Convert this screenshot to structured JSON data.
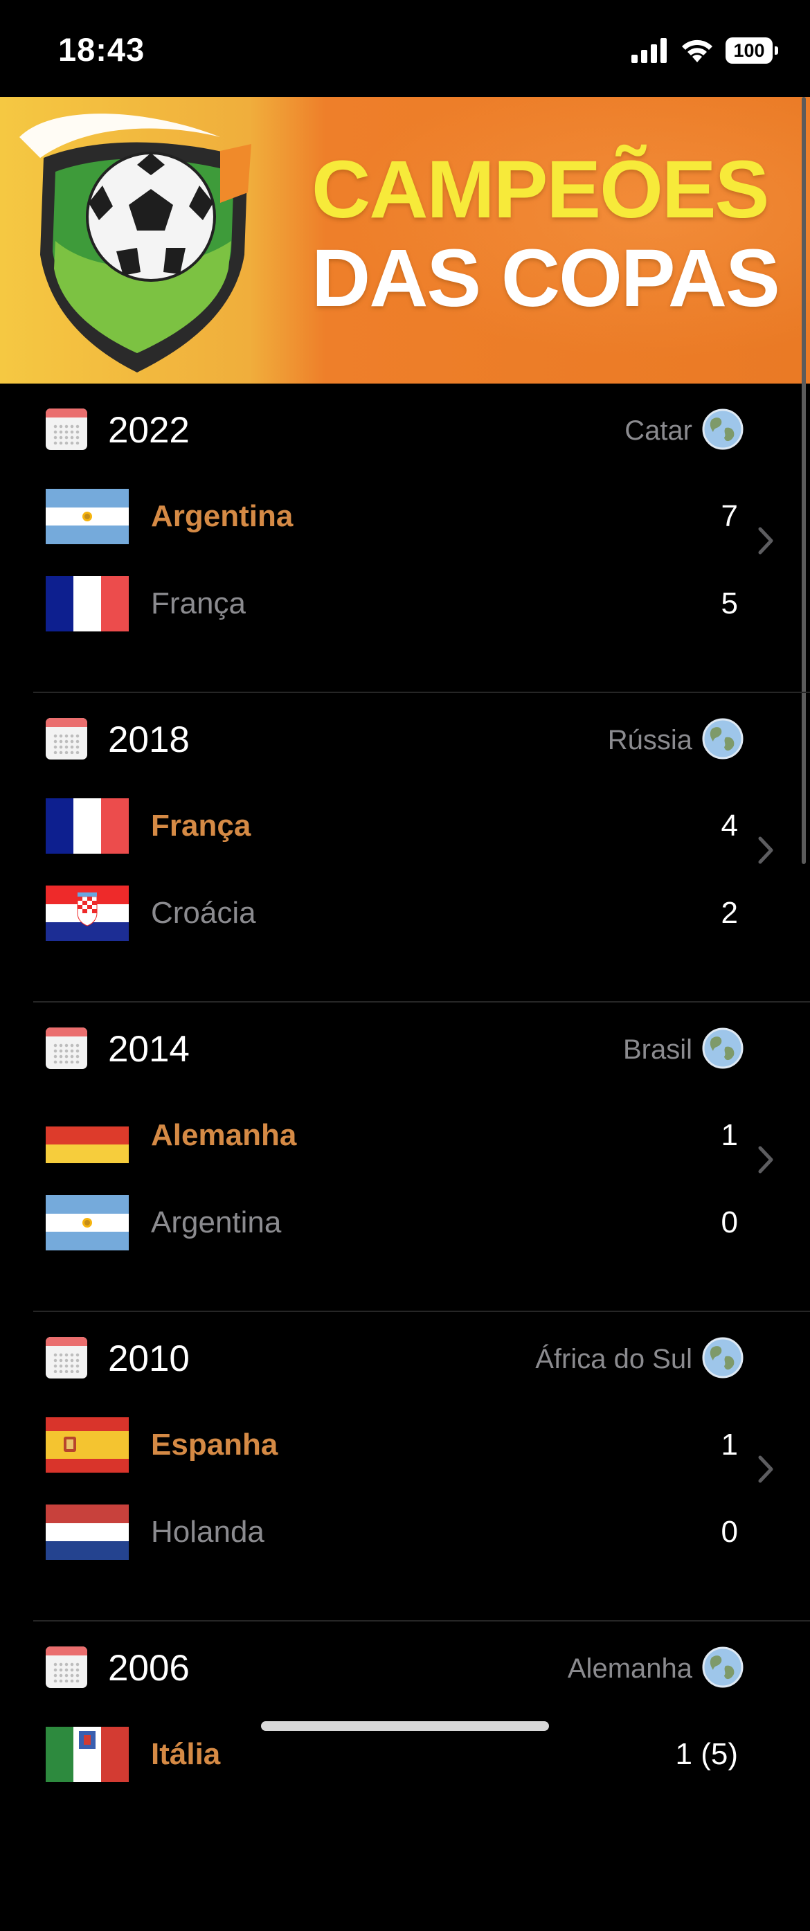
{
  "status_bar": {
    "time": "18:43",
    "battery": "100"
  },
  "banner": {
    "title_line1": "CAMPEÕES",
    "title_line2": "DAS COPAS"
  },
  "colors": {
    "winner": "#d58a45",
    "runner_up": "#8b8b8f",
    "banner_orange": "#ea7a25",
    "banner_yellow": "#f5c842"
  },
  "matches": [
    {
      "year": "2022",
      "host": "Catar",
      "winner": {
        "name": "Argentina",
        "score": "7",
        "flag": "argentina"
      },
      "runner_up": {
        "name": "França",
        "score": "5",
        "flag": "france"
      }
    },
    {
      "year": "2018",
      "host": "Rússia",
      "winner": {
        "name": "França",
        "score": "4",
        "flag": "france"
      },
      "runner_up": {
        "name": "Croácia",
        "score": "2",
        "flag": "croatia"
      }
    },
    {
      "year": "2014",
      "host": "Brasil",
      "winner": {
        "name": "Alemanha",
        "score": "1",
        "flag": "germany"
      },
      "runner_up": {
        "name": "Argentina",
        "score": "0",
        "flag": "argentina"
      }
    },
    {
      "year": "2010",
      "host": "África do Sul",
      "winner": {
        "name": "Espanha",
        "score": "1",
        "flag": "spain"
      },
      "runner_up": {
        "name": "Holanda",
        "score": "0",
        "flag": "netherlands"
      }
    },
    {
      "year": "2006",
      "host": "Alemanha",
      "winner": {
        "name": "Itália",
        "score": "1 (5)",
        "flag": "italy"
      },
      "runner_up": {
        "name": "",
        "score": "",
        "flag": ""
      }
    }
  ]
}
